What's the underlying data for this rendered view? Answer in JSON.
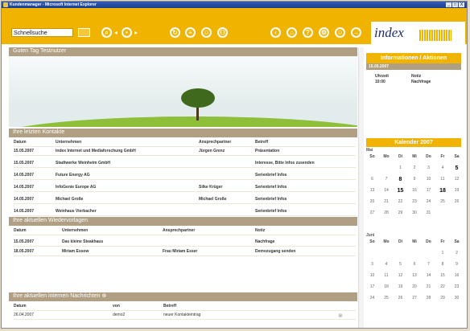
{
  "window": {
    "title": "Kundenmanager - Microsoft Internet Explorer",
    "controls": [
      "_",
      "□",
      "X"
    ]
  },
  "toolbar": {
    "search_value": "Schnellsuche",
    "logo_text": "index"
  },
  "greeting": "Guten Tag Testnutzer",
  "contacts": {
    "title": "Ihre letzten Kontakte",
    "columns": [
      "Datum",
      "Unternehmen",
      "Ansprechpartner",
      "Betreff"
    ],
    "rows": [
      [
        "15.05.2007",
        "index Internet und Mediaforschung GmbH",
        "Jürgen Grenz",
        "Präsentation"
      ],
      [
        "15.05.2007",
        "Stadtwerke Weinheim GmbH",
        "",
        "Interesse, Bitte Infos zusenden"
      ],
      [
        "14.05.2007",
        "Future Energy AG",
        "",
        "Serienbrief Infos"
      ],
      [
        "14.05.2007",
        "InfoGenie Europe AG",
        "Silke Krüger",
        "Serienbrief Infos"
      ],
      [
        "14.05.2007",
        "Michael Große",
        "Michael Große",
        "Serienbrief Infos"
      ],
      [
        "14.05.2007",
        "Weinhaus Vierbacher",
        "",
        "Serienbrief Infos"
      ]
    ]
  },
  "followups": {
    "title": "Ihre aktuellen Wiedervorlagen",
    "columns": [
      "Datum",
      "Unternehmen",
      "Ansprechpartner",
      "Notiz"
    ],
    "rows": [
      [
        "15.05.2007",
        "Das kleine Steakhaus",
        "",
        "Nachfrage"
      ],
      [
        "18.05.2007",
        "Miriam Essow",
        "Frau Miriam Esser",
        "Demozugang senden"
      ]
    ]
  },
  "messages": {
    "title": "Ihre aktuellen internen Nachrichten",
    "columns": [
      "Datum",
      "von",
      "Betreff"
    ],
    "rows": [
      [
        "26.04.2007",
        "demo2",
        "neuer Kontakteintrag"
      ]
    ]
  },
  "info_panel": {
    "title": "Informationen / Aktionen",
    "date": "15.05.2007",
    "columns": [
      "Uhrzeit",
      "Notiz"
    ],
    "rows": [
      [
        "10:00",
        "Nachfrage"
      ]
    ]
  },
  "calendar": {
    "title": "Kalender 2007",
    "weekdays": [
      "So",
      "Mo",
      "Di",
      "Mi",
      "Do",
      "Fr",
      "Sa"
    ],
    "may": {
      "label": "Mai",
      "weeks": [
        [
          "",
          "",
          "1",
          "2",
          "3",
          "4",
          "5"
        ],
        [
          "6",
          "7",
          "8",
          "9",
          "10",
          "11",
          "12"
        ],
        [
          "13",
          "14",
          "15",
          "16",
          "17",
          "18",
          "19"
        ],
        [
          "20",
          "21",
          "22",
          "23",
          "24",
          "25",
          "26"
        ],
        [
          "27",
          "28",
          "29",
          "30",
          "31",
          "",
          ""
        ]
      ],
      "highlighted": [
        "5",
        "8",
        "15",
        "18"
      ]
    },
    "june": {
      "label": "Juni",
      "weeks": [
        [
          "",
          "",
          "",
          "",
          "",
          "1",
          "2"
        ],
        [
          "3",
          "4",
          "5",
          "6",
          "7",
          "8",
          "9"
        ],
        [
          "10",
          "11",
          "12",
          "13",
          "14",
          "15",
          "16"
        ],
        [
          "17",
          "18",
          "19",
          "20",
          "21",
          "22",
          "23"
        ],
        [
          "24",
          "25",
          "26",
          "27",
          "28",
          "29",
          "30"
        ]
      ]
    }
  }
}
